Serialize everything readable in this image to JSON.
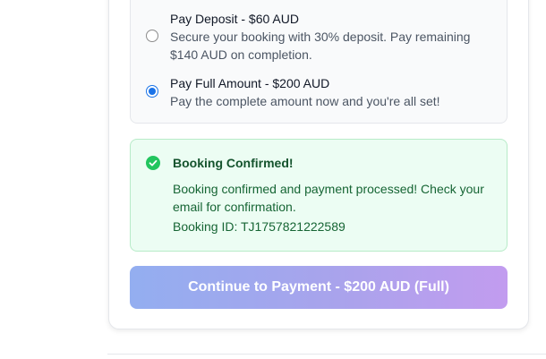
{
  "payment_options": [
    {
      "title": "Pay Deposit - $60 AUD",
      "description": "Secure your booking with 30% deposit. Pay remaining $140 AUD on completion.",
      "selected": false
    },
    {
      "title": "Pay Full Amount - $200 AUD",
      "description": "Pay the complete amount now and you're all set!",
      "selected": true
    }
  ],
  "confirmation": {
    "title": "Booking Confirmed!",
    "message": "Booking confirmed and payment processed! Check your email for confirmation.",
    "booking_id": "Booking ID: TJ1757821222589",
    "icon": "check-circle-icon"
  },
  "payment_button": {
    "label": "Continue to Payment - $200 AUD (Full)",
    "gradient": [
      "#93aef0",
      "#c29cef"
    ]
  },
  "colors": {
    "radio_accent": "#1a73e8",
    "success_bg": "#ecfdf3",
    "success_icon": "#22c55e"
  }
}
